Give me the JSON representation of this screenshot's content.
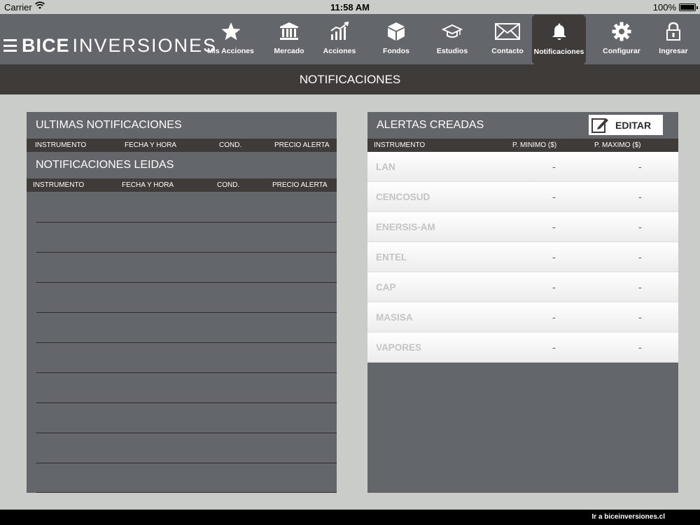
{
  "status_bar": {
    "carrier": "Carrier",
    "time": "11:58 AM",
    "battery": "100%",
    "battery_level": 1.0
  },
  "brand": {
    "bold": "BICE",
    "light": "INVERSIONES"
  },
  "nav": [
    {
      "label": "Mis Acciones",
      "icon": "star-icon"
    },
    {
      "label": "Mercado",
      "icon": "bank-icon"
    },
    {
      "label": "Acciones",
      "icon": "chart-icon"
    },
    {
      "label": "Fondos",
      "icon": "box-icon"
    },
    {
      "label": "Estudios",
      "icon": "graduation-cap-icon"
    },
    {
      "label": "Contacto",
      "icon": "envelope-icon"
    },
    {
      "label": "Notificaciones",
      "icon": "bell-icon",
      "active": true
    },
    {
      "label": "Configurar",
      "icon": "gear-icon"
    },
    {
      "label": "Ingresar",
      "icon": "lock-icon"
    }
  ],
  "page_title": "NOTIFICACIONES",
  "left_panel": {
    "ultimas_title": "ULTIMAS NOTIFICACIONES",
    "ultimas_columns": [
      "INSTRUMENTO",
      "FECHA Y HORA",
      "COND.",
      "PRECIO ALERTA"
    ],
    "leidas_title": "NOTIFICACIONES LEIDAS",
    "leidas_columns": [
      "INSTRUMENTO",
      "FECHA Y HORA",
      "COND.",
      "PRECIO ALERTA"
    ]
  },
  "right_panel": {
    "title": "ALERTAS CREADAS",
    "edit_label": "EDITAR",
    "columns": [
      "INSTRUMENTO",
      "P. MINIMO ($)",
      "P. MAXIMO ($)"
    ],
    "rows": [
      {
        "name": "LAN",
        "min": "-",
        "max": "-"
      },
      {
        "name": "CENCOSUD",
        "min": "-",
        "max": "-"
      },
      {
        "name": "ENERSIS-AM",
        "min": "-",
        "max": "-"
      },
      {
        "name": "ENTEL",
        "min": "-",
        "max": "-"
      },
      {
        "name": "CAP",
        "min": "-",
        "max": "-"
      },
      {
        "name": "MASISA",
        "min": "-",
        "max": "-"
      },
      {
        "name": "VAPORES",
        "min": "-",
        "max": "-"
      }
    ]
  },
  "footer": {
    "link": "Ir a biceinversiones.cl"
  },
  "colors": {
    "nav_bg": "#63666a",
    "dark": "#3e3b38",
    "background": "#c9ccc8"
  }
}
